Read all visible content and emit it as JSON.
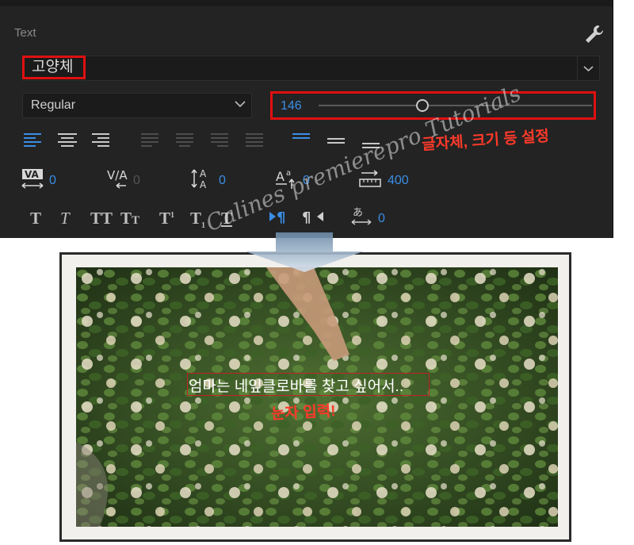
{
  "panel": {
    "title": "Text",
    "font_family": "고양체",
    "font_style": "Regular",
    "font_size": "146",
    "font_size_level": 0.38,
    "tracking": "0",
    "kerning": "0",
    "leading": "0",
    "baseline_shift": "0",
    "tab_width": "400",
    "tsume": "0"
  },
  "annotations": {
    "font_settings_note": "글자체, 크기 등 설정",
    "input_note": "눈자 입력!"
  },
  "preview": {
    "subtitle": "엄마는 네잎클로바를 찾고 싶어서..",
    "watermark": "Calines premierepro Tutorials"
  },
  "colors": {
    "accent_blue": "#3a8ee6",
    "highlight_red": "#e01010",
    "panel_bg": "#232323"
  }
}
